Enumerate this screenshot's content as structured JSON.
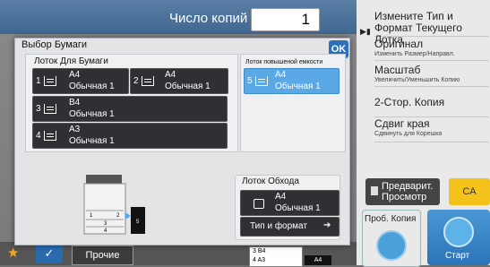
{
  "header": {
    "copies_label": "Число копий",
    "copies_value": "1"
  },
  "right_panel": {
    "items": [
      {
        "title": "Измените Тип и Формат Текущего Лотка",
        "sub": ""
      },
      {
        "title": "Оригинал",
        "sub": "Изменить Размер/Направл."
      },
      {
        "title": "Масштаб",
        "sub": "Увеличить/Уменьшить Копию"
      },
      {
        "title": "2-Стор. Копия",
        "sub": ""
      },
      {
        "title": "Сдвиг края",
        "sub": "Сдвинуть для Корешка"
      }
    ],
    "preview_label": "Предварит. Просмотр",
    "ca_label": "CA",
    "proof_label": "Проб. Копия",
    "start_label": "Старт"
  },
  "dialog": {
    "title": "Выбор Бумаги",
    "ok_label": "OK",
    "trays_label": "Лоток Для Бумаги",
    "trays": [
      {
        "num": "1",
        "size": "A4",
        "type": "Обычная 1"
      },
      {
        "num": "2",
        "size": "A4",
        "type": "Обычная 1"
      },
      {
        "num": "3",
        "size": "B4",
        "type": "Обычная 1"
      },
      {
        "num": "4",
        "size": "A3",
        "type": "Обычная 1"
      }
    ],
    "hc_label": "Лоток повышеной емкости",
    "hc_tray": {
      "num": "5",
      "size": "A4",
      "type": "Обычная 1",
      "selected": true
    },
    "bypass_label": "Лоток Обхода",
    "bypass_tray": {
      "size": "A4",
      "type": "Обычная 1"
    },
    "paper_type_label": "Тип и формат",
    "machine_labels": [
      "1",
      "2",
      "3",
      "4",
      "5"
    ]
  },
  "bottom": {
    "other_label": "Прочие",
    "mini_rows": [
      "3  B4",
      "4  A3"
    ],
    "mini_a4": "A4"
  },
  "colors": {
    "accent": "#2d72b8",
    "selected_tray": "#5aa9e6",
    "ca": "#f5c21b"
  }
}
